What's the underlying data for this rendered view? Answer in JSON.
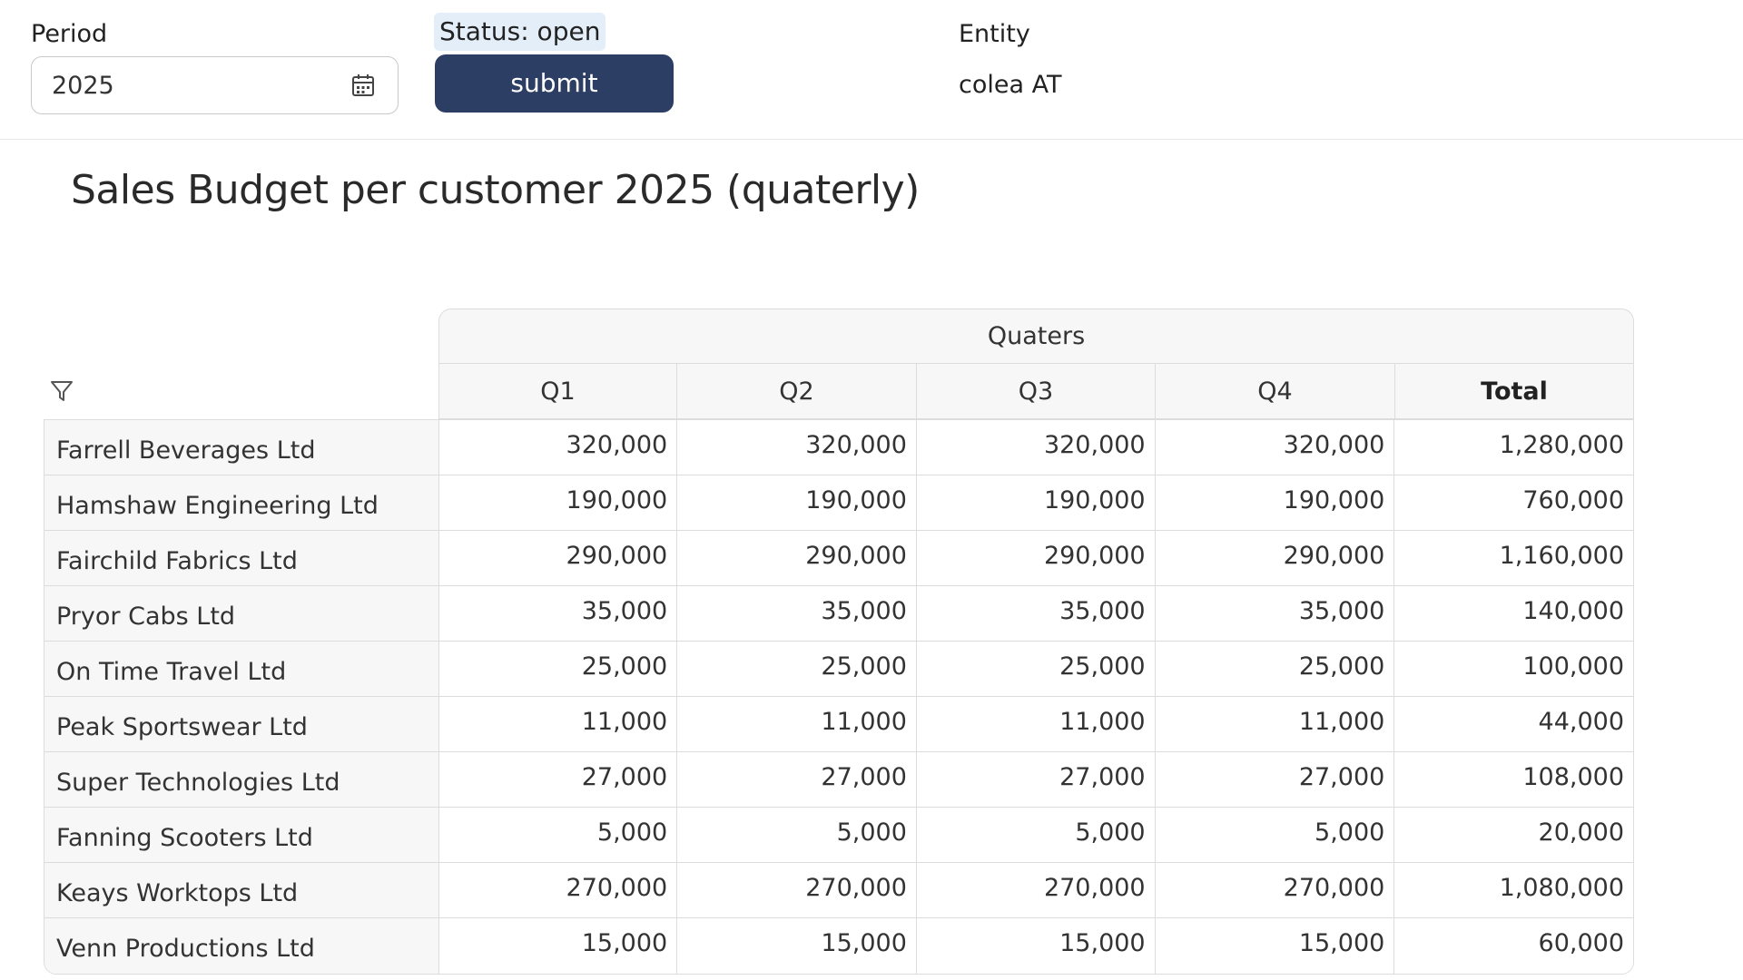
{
  "header": {
    "period_label": "Period",
    "period_value": "2025",
    "status_text": "Status: open",
    "submit_label": "submit",
    "entity_label": "Entity",
    "entity_value": "colea AT"
  },
  "icons": {
    "calendar": "calendar-icon",
    "filter": "filter-icon"
  },
  "colors": {
    "submit_bg": "#2c3e63",
    "status_bg": "#e3eef8",
    "header_bg": "#f7f7f7"
  },
  "page_title": "Sales Budget per customer 2025 (quaterly)",
  "table": {
    "group_header": "Quaters",
    "columns": [
      "Q1",
      "Q2",
      "Q3",
      "Q4",
      "Total"
    ],
    "rows": [
      {
        "name": "Farrell Beverages Ltd",
        "values": [
          "320,000",
          "320,000",
          "320,000",
          "320,000",
          "1,280,000"
        ]
      },
      {
        "name": "Hamshaw Engineering Ltd",
        "values": [
          "190,000",
          "190,000",
          "190,000",
          "190,000",
          "760,000"
        ]
      },
      {
        "name": "Fairchild Fabrics Ltd",
        "values": [
          "290,000",
          "290,000",
          "290,000",
          "290,000",
          "1,160,000"
        ]
      },
      {
        "name": "Pryor Cabs Ltd",
        "values": [
          "35,000",
          "35,000",
          "35,000",
          "35,000",
          "140,000"
        ]
      },
      {
        "name": "On Time Travel Ltd",
        "values": [
          "25,000",
          "25,000",
          "25,000",
          "25,000",
          "100,000"
        ]
      },
      {
        "name": "Peak Sportswear Ltd",
        "values": [
          "11,000",
          "11,000",
          "11,000",
          "11,000",
          "44,000"
        ]
      },
      {
        "name": "Super Technologies Ltd",
        "values": [
          "27,000",
          "27,000",
          "27,000",
          "27,000",
          "108,000"
        ]
      },
      {
        "name": "Fanning Scooters Ltd",
        "values": [
          "5,000",
          "5,000",
          "5,000",
          "5,000",
          "20,000"
        ]
      },
      {
        "name": "Keays Worktops Ltd",
        "values": [
          "270,000",
          "270,000",
          "270,000",
          "270,000",
          "1,080,000"
        ]
      },
      {
        "name": "Venn Productions Ltd",
        "values": [
          "15,000",
          "15,000",
          "15,000",
          "15,000",
          "60,000"
        ]
      }
    ]
  }
}
